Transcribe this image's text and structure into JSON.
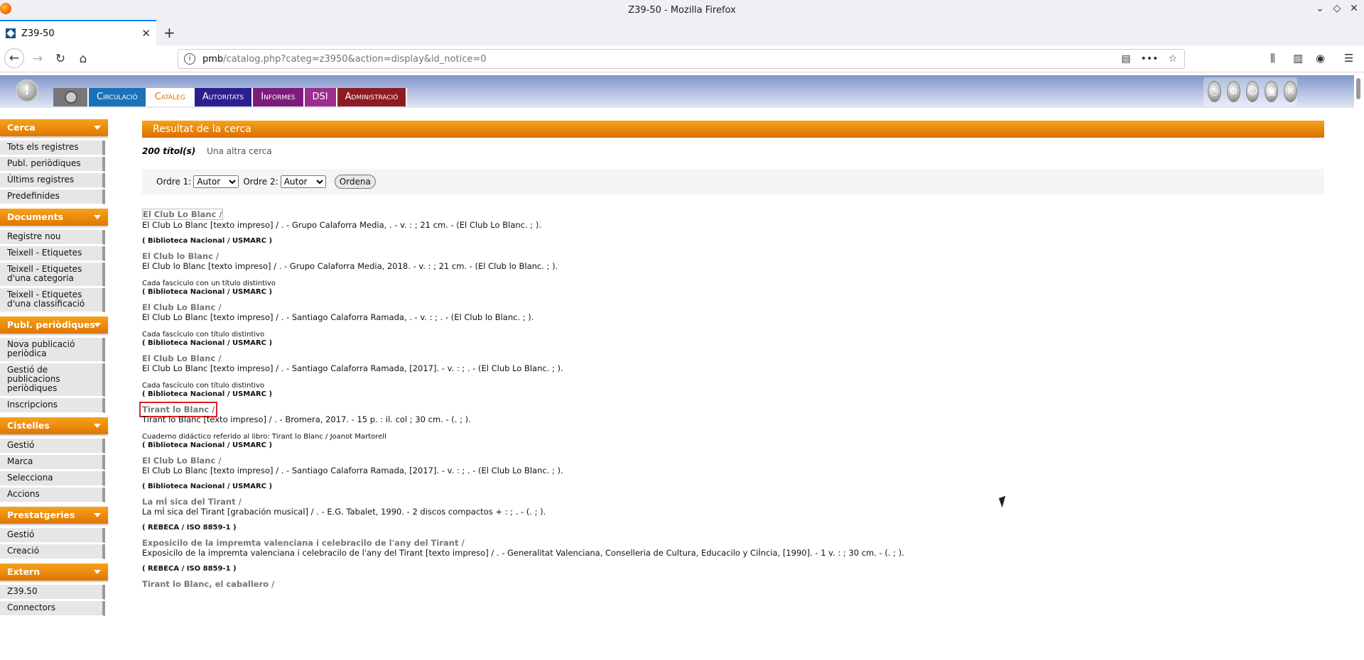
{
  "window": {
    "title": "Z39-50 - Mozilla Firefox"
  },
  "tab": {
    "title": "Z39-50"
  },
  "url": {
    "host": "pmb",
    "path": "/catalog.php?categ=z3950&action=display&id_notice=0"
  },
  "menu": [
    "Circulació",
    "Catàleg",
    "Autoritats",
    "Informes",
    "DSI",
    "Administració"
  ],
  "sidebar": {
    "cerca": {
      "title": "Cerca",
      "items": [
        "Tots els registres",
        "Publ. periòdiques",
        "Últims registres",
        "Predefinides"
      ]
    },
    "documents": {
      "title": "Documents",
      "items": [
        "Registre nou",
        "Teixell - Etiquetes",
        "Teixell - Etiquetes d'una categoria",
        "Teixell - Etiquetes d'una classificació"
      ]
    },
    "publ": {
      "title": "Publ. periòdiques",
      "items": [
        "Nova publicació periòdica",
        "Gestió de publicacions periòdiques",
        "Inscripcions"
      ]
    },
    "cistelles": {
      "title": "Cistelles",
      "items": [
        "Gestió",
        "Marca",
        "Selecciona",
        "Accions"
      ]
    },
    "prestatgeries": {
      "title": "Prestatgeries",
      "items": [
        "Gestió",
        "Creació"
      ]
    },
    "extern": {
      "title": "Extern",
      "items": [
        "Z39.50",
        "Connectors"
      ]
    }
  },
  "main": {
    "header": "Resultat de la cerca",
    "count": "200 títol(s)",
    "other_search": "Una altra cerca",
    "order1_label": "Ordre 1:",
    "order2_label": "Ordre 2:",
    "order1_value": "Autor",
    "order2_value": "Autor",
    "sort_button": "Ordena",
    "records": [
      {
        "title": "El Club Lo Blanc /",
        "desc": "El Club Lo Blanc [texto impreso] / . - Grupo Calaforra Media, . - v. : ; 21 cm. - (El Club Lo Blanc. ; ).",
        "note": "",
        "source": "( Biblioteca Nacional / USMARC )"
      },
      {
        "title": "El Club lo Blanc /",
        "desc": "El Club lo Blanc [texto impreso] / . - Grupo Calaforra Media, 2018. - v. : ; 21 cm. - (El Club lo Blanc. ; ).",
        "note": "Cada fascículo con un título distintivo",
        "source": "( Biblioteca Nacional / USMARC )"
      },
      {
        "title": "El Club Lo Blanc /",
        "desc": "El Club Lo Blanc [texto impreso] / . - Santiago Calaforra Ramada, . - v. : ; . - (El Club lo Blanc. ; ).",
        "note": "Cada fascículo con título distintivo",
        "source": "( Biblioteca Nacional / USMARC )"
      },
      {
        "title": "El Club Lo Blanc /",
        "desc": "El Club Lo Blanc [texto impreso] / . - Santiago Calaforra Ramada, [2017]. - v. : ; . - (El Club Lo Blanc. ; ).",
        "note": "Cada fascículo con título distintivo",
        "source": "( Biblioteca Nacional / USMARC )"
      },
      {
        "title": "Tirant lo Blanc /",
        "desc": "Tirant lo Blanc [texto impreso] / . - Bromera, 2017. - 15 p. : il. col ; 30 cm. - (. ; ).",
        "note": "Cuaderno didáctico referido al libro: Tirant lo Blanc / Joanot Martorell",
        "source": "( Biblioteca Nacional / USMARC )"
      },
      {
        "title": "El Club Lo Blanc /",
        "desc": "El Club Lo Blanc [texto impreso] / . - Santiago Calaforra Ramada, [2017]. - v. : ; . - (El Club Lo Blanc. ; ).",
        "note": "",
        "source": "( Biblioteca Nacional / USMARC )"
      },
      {
        "title": "La mÍ sica del Tirant /",
        "desc": "La mÍ sica del Tirant [grabación musical] / . - E.G. Tabalet, 1990. - 2 discos compactos + : ; . - (. ; ).",
        "note": "",
        "source": "( REBECA / ISO 8859-1 )"
      },
      {
        "title": "Exposicilo de la impremta valenciana i celebracilo de l'any del Tirant /",
        "desc": "Exposicilo de la impremta valenciana i celebracilo de l'any del Tirant [texto impreso] / . - Generalitat Valenciana, Conselleria de Cultura, Educacilo y CiÍncia, [1990]. - 1 v. : ; 30 cm. - (. ; ).",
        "note": "",
        "source": "( REBECA / ISO 8859-1 )"
      },
      {
        "title": "Tirant lo Blanc, el caballero /",
        "desc": "",
        "note": "",
        "source": ""
      }
    ]
  }
}
